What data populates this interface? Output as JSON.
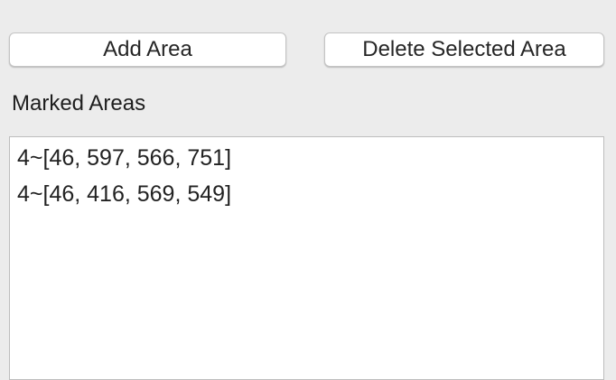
{
  "toolbar": {
    "add_label": "Add Area",
    "delete_label": "Delete Selected Area"
  },
  "marked_areas": {
    "label": "Marked Areas",
    "items": [
      "4~[46, 597, 566, 751]",
      "4~[46, 416, 569, 549]"
    ]
  }
}
